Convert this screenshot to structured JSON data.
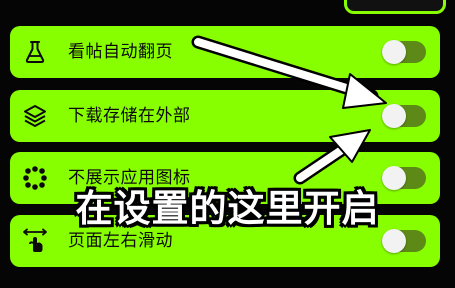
{
  "settings": {
    "items": [
      {
        "label": "看帖自动翻页",
        "icon": "flask-icon",
        "toggle_on": false
      },
      {
        "label": "下载存储在外部",
        "icon": "layers-icon",
        "toggle_on": false
      },
      {
        "label": "不展示应用图标",
        "icon": "dots-grid-icon",
        "toggle_on": false
      },
      {
        "label": "页面左右滑动",
        "icon": "swipe-hand-icon",
        "toggle_on": false
      }
    ]
  },
  "overlay": {
    "caption": "在设置的这里开启"
  },
  "colors": {
    "row_background": "#88ff00",
    "page_background": "#050505",
    "toggle_track": "#5d8a16",
    "toggle_knob": "#f2f2f2",
    "arrow": "#ffffff"
  }
}
